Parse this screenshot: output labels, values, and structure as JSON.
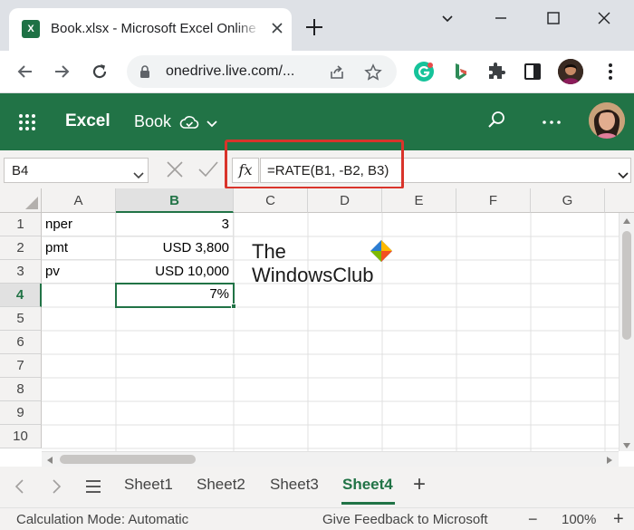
{
  "browser": {
    "tab_title": "Book.xlsx - Microsoft Excel Online",
    "tab_favicon": "X",
    "url": "onedrive.live.com/...",
    "icons": {
      "close": "close-icon",
      "new_tab": "plus-icon",
      "back": "back-arrow-icon",
      "forward": "forward-arrow-icon",
      "reload": "reload-icon",
      "lock": "lock-icon",
      "share": "share-icon",
      "star": "star-icon",
      "grammarly": "grammarly-icon",
      "bing": "bing-icon",
      "extensions": "puzzle-icon",
      "sidepanel": "side-panel-icon",
      "profile": "profile-avatar",
      "menu": "kebab-menu-icon"
    }
  },
  "excel": {
    "app_name": "Excel",
    "doc_name": "Book",
    "brand_color": "#217346",
    "accent_color": "#d9342b"
  },
  "formula_bar": {
    "name_box": "B4",
    "fx_label": "fx",
    "formula": "=RATE(B1, -B2, B3)"
  },
  "grid": {
    "columns": [
      "A",
      "B",
      "C",
      "D",
      "E",
      "F",
      "G"
    ],
    "rows": [
      "1",
      "2",
      "3",
      "4",
      "5",
      "6",
      "7",
      "8",
      "9",
      "10"
    ],
    "selected_column": "B",
    "selected_row": "4",
    "cells": {
      "A1": "nper",
      "B1": "3",
      "A2": "pmt",
      "B2": "USD 3,800",
      "A3": "pv",
      "B3": "USD 10,000",
      "B4": "7%"
    }
  },
  "watermark": {
    "line1": "The",
    "line2": "WindowsClub"
  },
  "sheets": {
    "tabs": [
      "Sheet1",
      "Sheet2",
      "Sheet3",
      "Sheet4"
    ],
    "active": "Sheet4",
    "add_label": "+"
  },
  "status": {
    "calc_mode": "Calculation Mode: Automatic",
    "feedback": "Give Feedback to Microsoft",
    "zoom_minus": "−",
    "zoom": "100%",
    "zoom_plus": "+"
  }
}
